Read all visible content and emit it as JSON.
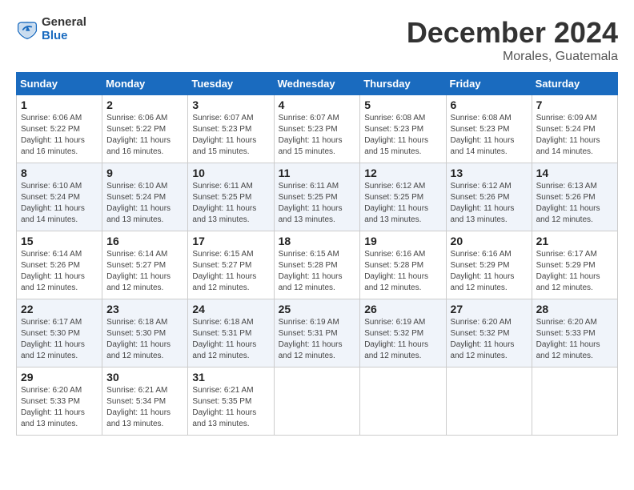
{
  "logo": {
    "general": "General",
    "blue": "Blue"
  },
  "title": "December 2024",
  "location": "Morales, Guatemala",
  "weekdays": [
    "Sunday",
    "Monday",
    "Tuesday",
    "Wednesday",
    "Thursday",
    "Friday",
    "Saturday"
  ],
  "weeks": [
    [
      {
        "day": "1",
        "sunrise": "6:06 AM",
        "sunset": "5:22 PM",
        "daylight": "11 hours and 16 minutes."
      },
      {
        "day": "2",
        "sunrise": "6:06 AM",
        "sunset": "5:22 PM",
        "daylight": "11 hours and 16 minutes."
      },
      {
        "day": "3",
        "sunrise": "6:07 AM",
        "sunset": "5:23 PM",
        "daylight": "11 hours and 15 minutes."
      },
      {
        "day": "4",
        "sunrise": "6:07 AM",
        "sunset": "5:23 PM",
        "daylight": "11 hours and 15 minutes."
      },
      {
        "day": "5",
        "sunrise": "6:08 AM",
        "sunset": "5:23 PM",
        "daylight": "11 hours and 15 minutes."
      },
      {
        "day": "6",
        "sunrise": "6:08 AM",
        "sunset": "5:23 PM",
        "daylight": "11 hours and 14 minutes."
      },
      {
        "day": "7",
        "sunrise": "6:09 AM",
        "sunset": "5:24 PM",
        "daylight": "11 hours and 14 minutes."
      }
    ],
    [
      {
        "day": "8",
        "sunrise": "6:10 AM",
        "sunset": "5:24 PM",
        "daylight": "11 hours and 14 minutes."
      },
      {
        "day": "9",
        "sunrise": "6:10 AM",
        "sunset": "5:24 PM",
        "daylight": "11 hours and 13 minutes."
      },
      {
        "day": "10",
        "sunrise": "6:11 AM",
        "sunset": "5:25 PM",
        "daylight": "11 hours and 13 minutes."
      },
      {
        "day": "11",
        "sunrise": "6:11 AM",
        "sunset": "5:25 PM",
        "daylight": "11 hours and 13 minutes."
      },
      {
        "day": "12",
        "sunrise": "6:12 AM",
        "sunset": "5:25 PM",
        "daylight": "11 hours and 13 minutes."
      },
      {
        "day": "13",
        "sunrise": "6:12 AM",
        "sunset": "5:26 PM",
        "daylight": "11 hours and 13 minutes."
      },
      {
        "day": "14",
        "sunrise": "6:13 AM",
        "sunset": "5:26 PM",
        "daylight": "11 hours and 12 minutes."
      }
    ],
    [
      {
        "day": "15",
        "sunrise": "6:14 AM",
        "sunset": "5:26 PM",
        "daylight": "11 hours and 12 minutes."
      },
      {
        "day": "16",
        "sunrise": "6:14 AM",
        "sunset": "5:27 PM",
        "daylight": "11 hours and 12 minutes."
      },
      {
        "day": "17",
        "sunrise": "6:15 AM",
        "sunset": "5:27 PM",
        "daylight": "11 hours and 12 minutes."
      },
      {
        "day": "18",
        "sunrise": "6:15 AM",
        "sunset": "5:28 PM",
        "daylight": "11 hours and 12 minutes."
      },
      {
        "day": "19",
        "sunrise": "6:16 AM",
        "sunset": "5:28 PM",
        "daylight": "11 hours and 12 minutes."
      },
      {
        "day": "20",
        "sunrise": "6:16 AM",
        "sunset": "5:29 PM",
        "daylight": "11 hours and 12 minutes."
      },
      {
        "day": "21",
        "sunrise": "6:17 AM",
        "sunset": "5:29 PM",
        "daylight": "11 hours and 12 minutes."
      }
    ],
    [
      {
        "day": "22",
        "sunrise": "6:17 AM",
        "sunset": "5:30 PM",
        "daylight": "11 hours and 12 minutes."
      },
      {
        "day": "23",
        "sunrise": "6:18 AM",
        "sunset": "5:30 PM",
        "daylight": "11 hours and 12 minutes."
      },
      {
        "day": "24",
        "sunrise": "6:18 AM",
        "sunset": "5:31 PM",
        "daylight": "11 hours and 12 minutes."
      },
      {
        "day": "25",
        "sunrise": "6:19 AM",
        "sunset": "5:31 PM",
        "daylight": "11 hours and 12 minutes."
      },
      {
        "day": "26",
        "sunrise": "6:19 AM",
        "sunset": "5:32 PM",
        "daylight": "11 hours and 12 minutes."
      },
      {
        "day": "27",
        "sunrise": "6:20 AM",
        "sunset": "5:32 PM",
        "daylight": "11 hours and 12 minutes."
      },
      {
        "day": "28",
        "sunrise": "6:20 AM",
        "sunset": "5:33 PM",
        "daylight": "11 hours and 12 minutes."
      }
    ],
    [
      {
        "day": "29",
        "sunrise": "6:20 AM",
        "sunset": "5:33 PM",
        "daylight": "11 hours and 13 minutes."
      },
      {
        "day": "30",
        "sunrise": "6:21 AM",
        "sunset": "5:34 PM",
        "daylight": "11 hours and 13 minutes."
      },
      {
        "day": "31",
        "sunrise": "6:21 AM",
        "sunset": "5:35 PM",
        "daylight": "11 hours and 13 minutes."
      },
      null,
      null,
      null,
      null
    ]
  ],
  "labels": {
    "sunrise": "Sunrise:",
    "sunset": "Sunset:",
    "daylight": "Daylight:"
  }
}
